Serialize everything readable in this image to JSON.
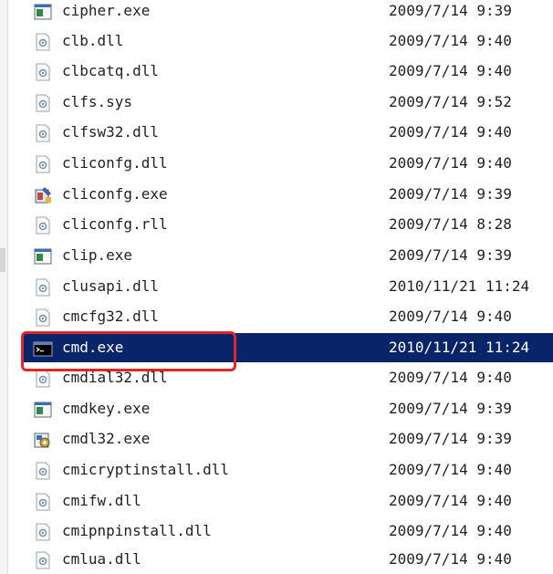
{
  "files": [
    {
      "name": "cipher.exe",
      "date": "2009/7/14 9:39",
      "icon": "exe-window-icon"
    },
    {
      "name": "clb.dll",
      "date": "2009/7/14 9:40",
      "icon": "dll-icon"
    },
    {
      "name": "clbcatq.dll",
      "date": "2009/7/14 9:40",
      "icon": "dll-icon"
    },
    {
      "name": "clfs.sys",
      "date": "2009/7/14 9:52",
      "icon": "dll-icon"
    },
    {
      "name": "clfsw32.dll",
      "date": "2009/7/14 9:40",
      "icon": "dll-icon"
    },
    {
      "name": "cliconfg.dll",
      "date": "2009/7/14 9:40",
      "icon": "dll-icon"
    },
    {
      "name": "cliconfg.exe",
      "date": "2009/7/14 9:39",
      "icon": "config-app-icon"
    },
    {
      "name": "cliconfg.rll",
      "date": "2009/7/14 8:28",
      "icon": "dll-icon"
    },
    {
      "name": "clip.exe",
      "date": "2009/7/14 9:39",
      "icon": "exe-window-icon"
    },
    {
      "name": "clusapi.dll",
      "date": "2010/11/21 11:24",
      "icon": "dll-icon"
    },
    {
      "name": "cmcfg32.dll",
      "date": "2009/7/14 9:40",
      "icon": "dll-icon"
    },
    {
      "name": "cmd.exe",
      "date": "2010/11/21 11:24",
      "icon": "cmd-console-icon",
      "selected": true
    },
    {
      "name": "cmdial32.dll",
      "date": "2009/7/14 9:40",
      "icon": "dll-icon"
    },
    {
      "name": "cmdkey.exe",
      "date": "2009/7/14 9:39",
      "icon": "exe-window-icon"
    },
    {
      "name": "cmdl32.exe",
      "date": "2009/7/14 9:39",
      "icon": "gear-app-icon"
    },
    {
      "name": "cmicryptinstall.dll",
      "date": "2009/7/14 9:40",
      "icon": "dll-icon"
    },
    {
      "name": "cmifw.dll",
      "date": "2009/7/14 9:40",
      "icon": "dll-icon"
    },
    {
      "name": "cmipnpinstall.dll",
      "date": "2009/7/14 9:40",
      "icon": "dll-icon"
    },
    {
      "name": "cmlua.dll",
      "date": "2009/7/14 9:40",
      "icon": "dll-icon"
    }
  ],
  "colors": {
    "selection": "#0a246a",
    "highlight_border": "#e0262b"
  }
}
